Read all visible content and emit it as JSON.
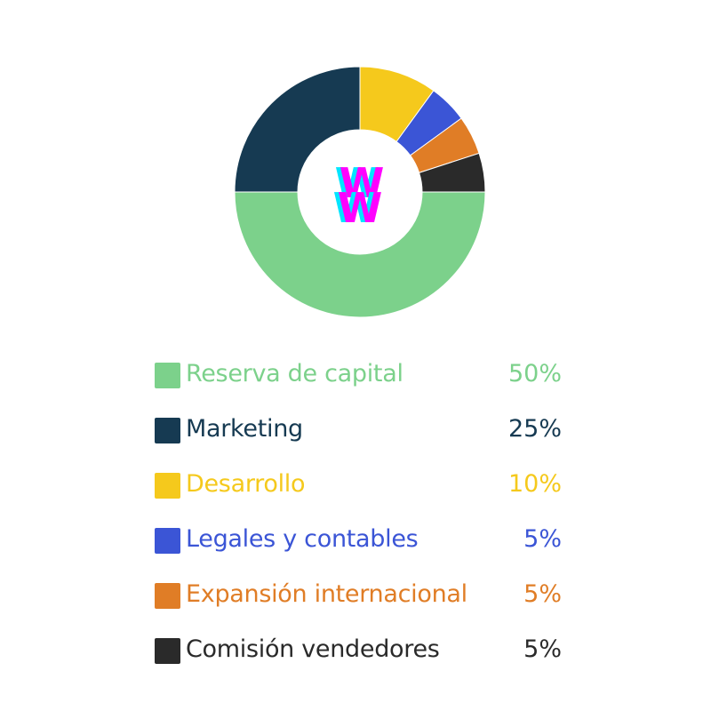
{
  "chart_data": {
    "type": "pie",
    "style": "donut",
    "labels": [
      "Reserva de capital",
      "Marketing",
      "Desarrollo",
      "Legales y contables",
      "Expansión internacional",
      "Comisión vendedores"
    ],
    "values": [
      50,
      25,
      10,
      5,
      5,
      5
    ],
    "value_labels": [
      "50%",
      "25%",
      "10%",
      "5%",
      "5%",
      "5%"
    ],
    "colors": [
      "#7cd18b",
      "#163a52",
      "#f5c91c",
      "#3b55d6",
      "#e07d26",
      "#2a2a2a"
    ],
    "legend_text_colors": [
      "#7cd18b",
      "#163a52",
      "#f5c91c",
      "#3b55d6",
      "#e07d26",
      "#2a2a2a"
    ],
    "legend_position": "bottom"
  },
  "center_logo": {
    "text": "W",
    "colors": [
      "#ff00ff",
      "#00e5ff"
    ]
  }
}
